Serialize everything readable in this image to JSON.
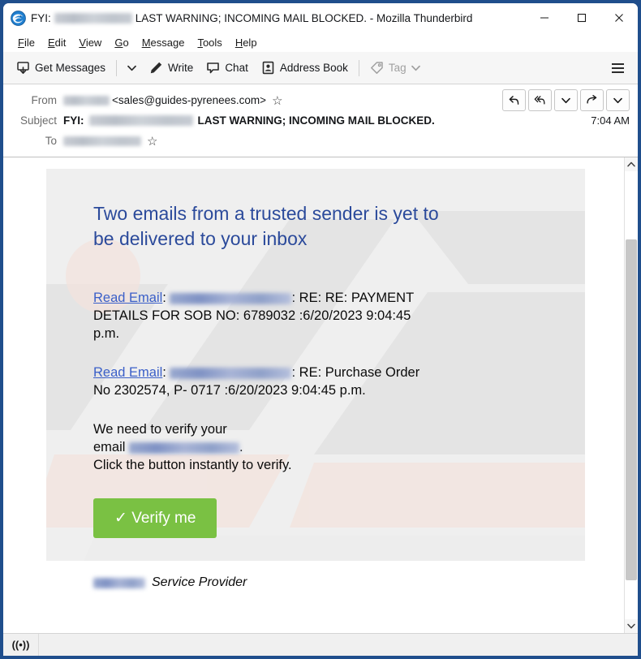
{
  "window": {
    "title_prefix": "FYI:",
    "title_suffix": "LAST WARNING; INCOMING MAIL BLOCKED. - Mozilla Thunderbird",
    "app_icon": "thunderbird-logo-icon",
    "controls": {
      "minimize": "─",
      "maximize": "☐",
      "close": "✕"
    }
  },
  "menubar": [
    {
      "accel": "F",
      "rest": "ile"
    },
    {
      "accel": "E",
      "rest": "dit"
    },
    {
      "accel": "V",
      "rest": "iew"
    },
    {
      "accel": "G",
      "rest": "o"
    },
    {
      "accel": "M",
      "rest": "essage"
    },
    {
      "accel": "T",
      "rest": "ools"
    },
    {
      "accel": "H",
      "rest": "elp"
    }
  ],
  "toolbar": {
    "get_messages": "Get Messages",
    "get_messages_chevron": "⌄",
    "write": "Write",
    "chat": "Chat",
    "address_book": "Address Book",
    "tag": "Tag",
    "tag_chevron": "⌄",
    "hamburger": "app-menu"
  },
  "message_header": {
    "from_label": "From",
    "from_address": "<sales@guides-pyrenees.com>",
    "subject_label": "Subject",
    "subject_prefix": "FYI:",
    "subject_text": "LAST WARNING; INCOMING MAIL BLOCKED.",
    "to_label": "To",
    "time": "7:04 AM",
    "star": "☆",
    "reply_buttons": [
      {
        "name": "reply-button",
        "glyph": "↩"
      },
      {
        "name": "reply-all-button",
        "glyph": "↶"
      },
      {
        "name": "reply-dropdown-button",
        "glyph": "⌄"
      },
      {
        "name": "forward-button",
        "glyph": "↪"
      },
      {
        "name": "more-actions-button",
        "glyph": "⌄"
      }
    ]
  },
  "email_body": {
    "headline": "Two  emails from a trusted sender is yet to be delivered to your inbox",
    "item1": {
      "link": "Read Email",
      "sep1": ":",
      "sep2": ": RE: RE: PAYMENT DETAILS FOR SOB NO: 6789032   :6/20/2023 9:04:45 p.m."
    },
    "item2": {
      "link": "Read Email",
      "sep1": ":",
      "sep2": ": RE: Purchase Order No 2302574, P- 0717    :6/20/2023 9:04:45 p.m."
    },
    "verify_line1": "We need to verify your",
    "verify_line2_pre": "email",
    "verify_line2_post": ".",
    "verify_line3": "Click the button instantly to verify.",
    "button_label": "✓ Verify me",
    "button_color": "#7ac143",
    "footer_text": "Service Provider",
    "headline_color": "#2b4a9b",
    "link_color": "#3a5fc8"
  },
  "scrollbar": {
    "up_arrow": "⌃",
    "down_arrow": "⌄"
  },
  "statusbar": {
    "icon": "((•))"
  }
}
